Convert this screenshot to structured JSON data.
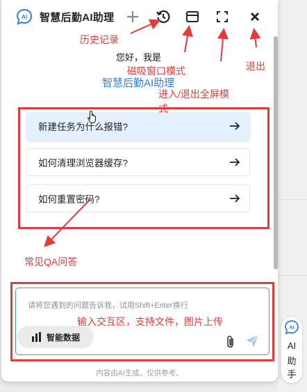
{
  "header": {
    "title": "智慧后勤AI助理"
  },
  "greeting": {
    "line1": "您好，我是",
    "line2": "智慧后勤AI助理"
  },
  "faq": [
    {
      "label": "新建任务为什么报错?"
    },
    {
      "label": "如何清理浏览器缓存?"
    },
    {
      "label": "如何重置密码?"
    }
  ],
  "input": {
    "placeholder": "请将您遇到的问题告诉我，试用Shift+Enter换行",
    "data_button_label": "智能数据"
  },
  "footer": "内容由AI生成，仅供参考。",
  "side_button": {
    "chars": [
      "AI",
      "助",
      "手"
    ]
  },
  "annotations": {
    "history": "历史记录",
    "dock": "磁吸窗口模式",
    "fullscreen_line1": "进入/退出全屏模",
    "fullscreen_line2": "式",
    "exit": "退出",
    "faq": "常见QA问答",
    "input": "输入交互区，支持文件，图片上传"
  },
  "colors": {
    "accent": "#2f82dc",
    "annotation": "#e63a3a",
    "faq_active_bg": "#e4efff",
    "input_border": "#4d8fe8"
  },
  "icons": [
    "ai-logo-icon",
    "plus-icon",
    "history-icon",
    "dock-window-icon",
    "fullscreen-icon",
    "close-icon",
    "arrow-right-icon",
    "bar-chart-icon",
    "paperclip-icon",
    "send-icon",
    "pointer-cursor-icon"
  ]
}
